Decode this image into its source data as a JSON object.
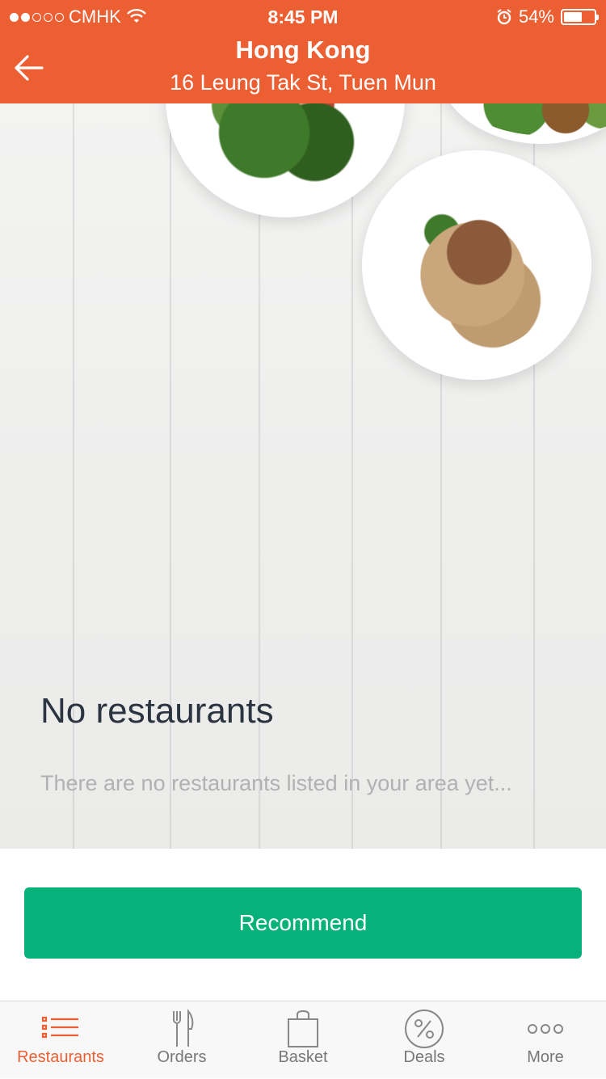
{
  "status_bar": {
    "carrier": "CMHK",
    "time": "8:45 PM",
    "battery": "54%",
    "signal_dots_filled": 2,
    "signal_dots_total": 5
  },
  "header": {
    "title": "Hong Kong",
    "subtitle": "16 Leung Tak St, Tuen Mun",
    "back_icon": "arrow-left-icon",
    "color": "#EB5F33"
  },
  "empty_state": {
    "title": "No restaurants",
    "message": "There are no restaurants listed in your area yet..."
  },
  "action": {
    "label": "Recommend",
    "color": "#07B27A"
  },
  "tabs": [
    {
      "label": "Restaurants",
      "icon": "list-icon",
      "active": true
    },
    {
      "label": "Orders",
      "icon": "fork-knife-icon",
      "active": false
    },
    {
      "label": "Basket",
      "icon": "bag-icon",
      "active": false
    },
    {
      "label": "Deals",
      "icon": "percent-icon",
      "active": false
    },
    {
      "label": "More",
      "icon": "more-dots-icon",
      "active": false
    }
  ]
}
